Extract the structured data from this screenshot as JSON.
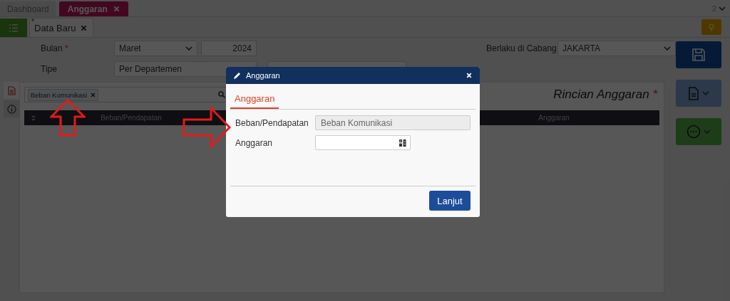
{
  "top_tabs": [
    {
      "label": "Dashboard",
      "selected": false,
      "closable": false
    },
    {
      "label": "Anggaran",
      "selected": true,
      "closable": true
    }
  ],
  "window_count": "2",
  "doc_tabs": [
    {
      "label": "Data Baru",
      "mark": "*"
    }
  ],
  "form": {
    "bulan": {
      "label": "Bulan",
      "required_mark": "*",
      "month": "Maret",
      "year": "2024"
    },
    "tipe": {
      "label": "Tipe",
      "value": "Per Departemen"
    },
    "cabang": {
      "label": "Berlaku di Cabang",
      "value": "JAKARTA"
    }
  },
  "side_tabs": [
    {
      "kind": "document",
      "selected": true
    },
    {
      "kind": "info",
      "selected": false
    }
  ],
  "panel": {
    "filter_chip": "Beban Komunikasi",
    "title": "Rincian Anggaran",
    "required_mark": "*",
    "columns": [
      "Beban/Pendapatan",
      "Anggaran"
    ]
  },
  "modal": {
    "title": "Anggaran",
    "tabs": [
      {
        "label": "Anggaran",
        "selected": true
      }
    ],
    "fields": [
      {
        "kind": "text",
        "label": "Beban/Pendapatan",
        "value": "Beban Komunikasi",
        "disabled": true
      },
      {
        "kind": "calculator",
        "label": "Anggaran",
        "disabled": false
      }
    ],
    "button": "Lanjut"
  }
}
